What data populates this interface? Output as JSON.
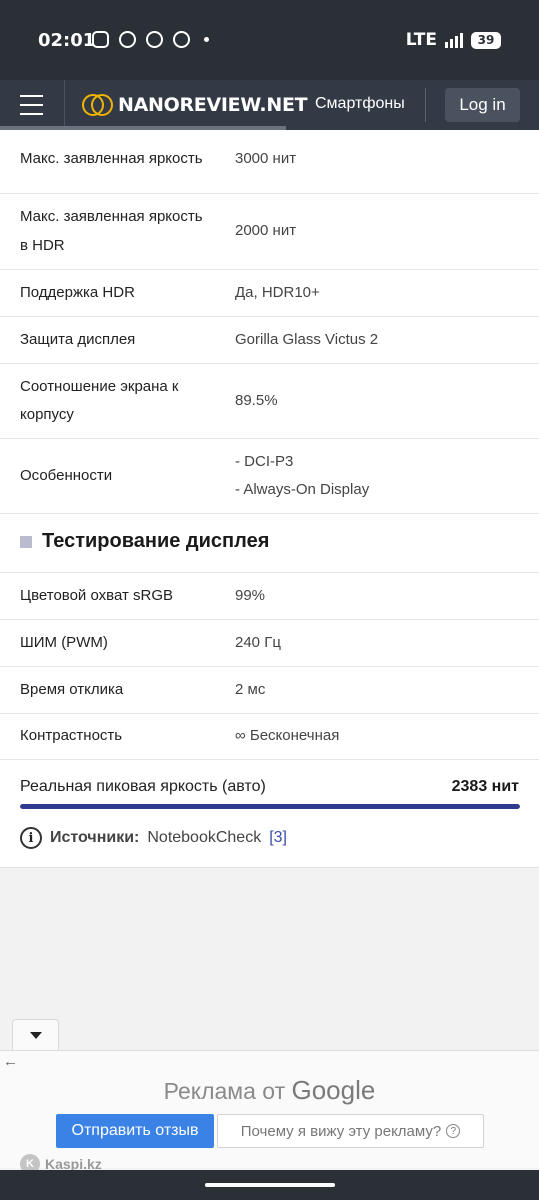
{
  "status_bar": {
    "time": "02:01",
    "network": "LTE",
    "battery": "39",
    "notification_icons": [
      "instagram-icon",
      "whatsapp-icon",
      "chat-icon",
      "kaspi-icon"
    ]
  },
  "header": {
    "logo_text": "NANOREVIEW.NET",
    "nav_phones": "Смартфоны",
    "login": "Log in"
  },
  "specs": [
    {
      "label": "Макс. заявленная яркость",
      "value": "3000 нит"
    },
    {
      "label": "Макс. заявленная яркость в HDR",
      "value": "2000 нит"
    },
    {
      "label": "Поддержка HDR",
      "value": "Да, HDR10+"
    },
    {
      "label": "Защита дисплея",
      "value": "Gorilla Glass Victus 2"
    },
    {
      "label": "Соотношение экрана к корпусу",
      "value": "89.5%"
    },
    {
      "label": "Особенности",
      "values": [
        "- DCI-P3",
        "- Always-On Display"
      ]
    }
  ],
  "testing": {
    "title": "Тестирование дисплея",
    "rows": [
      {
        "label": "Цветовой охват sRGB",
        "value": "99%"
      },
      {
        "label": "ШИМ (PWM)",
        "value": "240 Гц"
      },
      {
        "label": "Время отклика",
        "value": "2 мс"
      },
      {
        "label": "Контрастность",
        "value": "∞ Бесконечная"
      }
    ],
    "peak_brightness_label": "Реальная пиковая яркость (авто)",
    "peak_brightness_value": "2383 нит",
    "peak_brightness_fill_percent": 100
  },
  "sources": {
    "label": "Источники:",
    "value": "NotebookCheck",
    "link": "[3]"
  },
  "ad": {
    "back_arrow": "←",
    "title_prefix": "Реклама от",
    "title_brand": "Google",
    "feedback_button": "Отправить отзыв",
    "why_button": "Почему я вижу эту рекламу?",
    "advertiser": "Kaspi.kz"
  }
}
